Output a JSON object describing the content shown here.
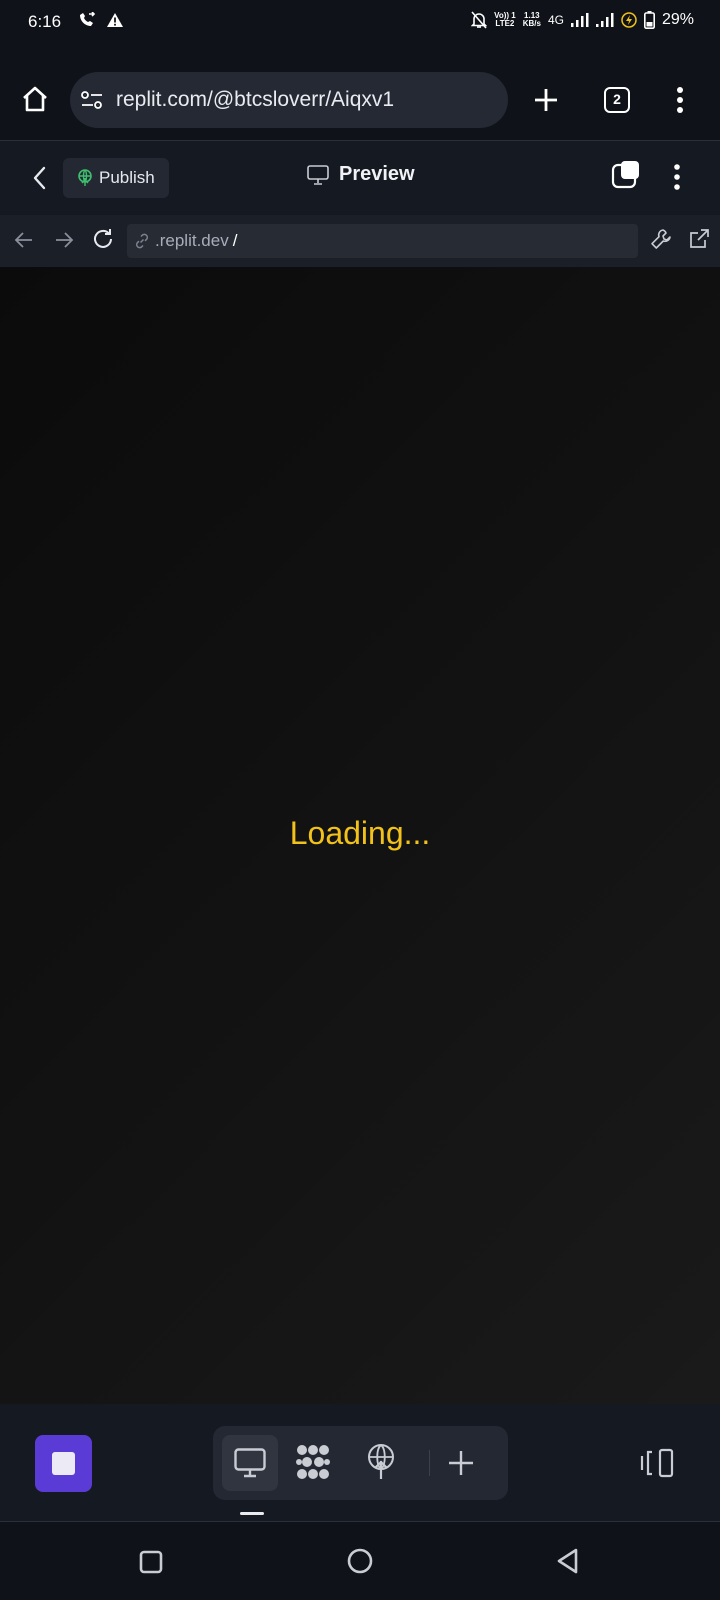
{
  "status_bar": {
    "time": "6:16",
    "network_top": "Vo)) 1",
    "network_bottom": "LTE2",
    "speed_top": "1.13",
    "speed_bottom": "KB/s",
    "network_type": "4G",
    "battery": "29%"
  },
  "browser": {
    "url": "replit.com/@btcsloverr/Aiqxv1",
    "tab_count": "2"
  },
  "app_header": {
    "publish_label": "Publish",
    "title": "Preview"
  },
  "preview_nav": {
    "address": ".replit.dev",
    "address_slash": "/"
  },
  "preview": {
    "loading_text": "Loading..."
  },
  "colors": {
    "accent_purple": "#5b3bd6",
    "loading_yellow": "#f2c21b",
    "publish_green": "#3fbf6e"
  }
}
